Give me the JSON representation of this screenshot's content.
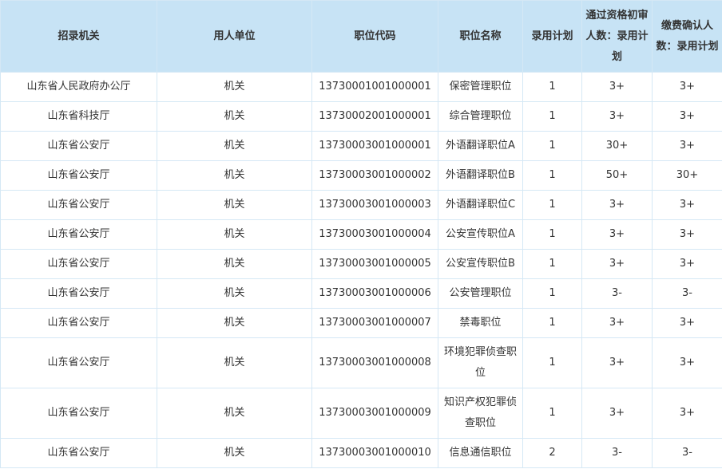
{
  "table": {
    "headers": [
      "招录机关",
      "用人单位",
      "职位代码",
      "职位名称",
      "录用计划",
      "通过资格初审人数：录用计划",
      "缴费确认人数：录用计划"
    ],
    "rows": [
      [
        "山东省人民政府办公厅",
        "机关",
        "13730001001000001",
        "保密管理职位",
        "1",
        "3+",
        "3+"
      ],
      [
        "山东省科技厅",
        "机关",
        "13730002001000001",
        "综合管理职位",
        "1",
        "3+",
        "3+"
      ],
      [
        "山东省公安厅",
        "机关",
        "13730003001000001",
        "外语翻译职位A",
        "1",
        "30+",
        "3+"
      ],
      [
        "山东省公安厅",
        "机关",
        "13730003001000002",
        "外语翻译职位B",
        "1",
        "50+",
        "30+"
      ],
      [
        "山东省公安厅",
        "机关",
        "13730003001000003",
        "外语翻译职位C",
        "1",
        "3+",
        "3+"
      ],
      [
        "山东省公安厅",
        "机关",
        "13730003001000004",
        "公安宣传职位A",
        "1",
        "3+",
        "3+"
      ],
      [
        "山东省公安厅",
        "机关",
        "13730003001000005",
        "公安宣传职位B",
        "1",
        "3+",
        "3+"
      ],
      [
        "山东省公安厅",
        "机关",
        "13730003001000006",
        "公安管理职位",
        "1",
        "3-",
        "3-"
      ],
      [
        "山东省公安厅",
        "机关",
        "13730003001000007",
        "禁毒职位",
        "1",
        "3+",
        "3+"
      ],
      [
        "山东省公安厅",
        "机关",
        "13730003001000008",
        "环境犯罪侦查职位",
        "1",
        "3+",
        "3+"
      ],
      [
        "山东省公安厅",
        "机关",
        "13730003001000009",
        "知识产权犯罪侦查职位",
        "1",
        "3+",
        "3+"
      ],
      [
        "山东省公安厅",
        "机关",
        "13730003001000010",
        "信息通信职位",
        "2",
        "3-",
        "3-"
      ]
    ]
  }
}
